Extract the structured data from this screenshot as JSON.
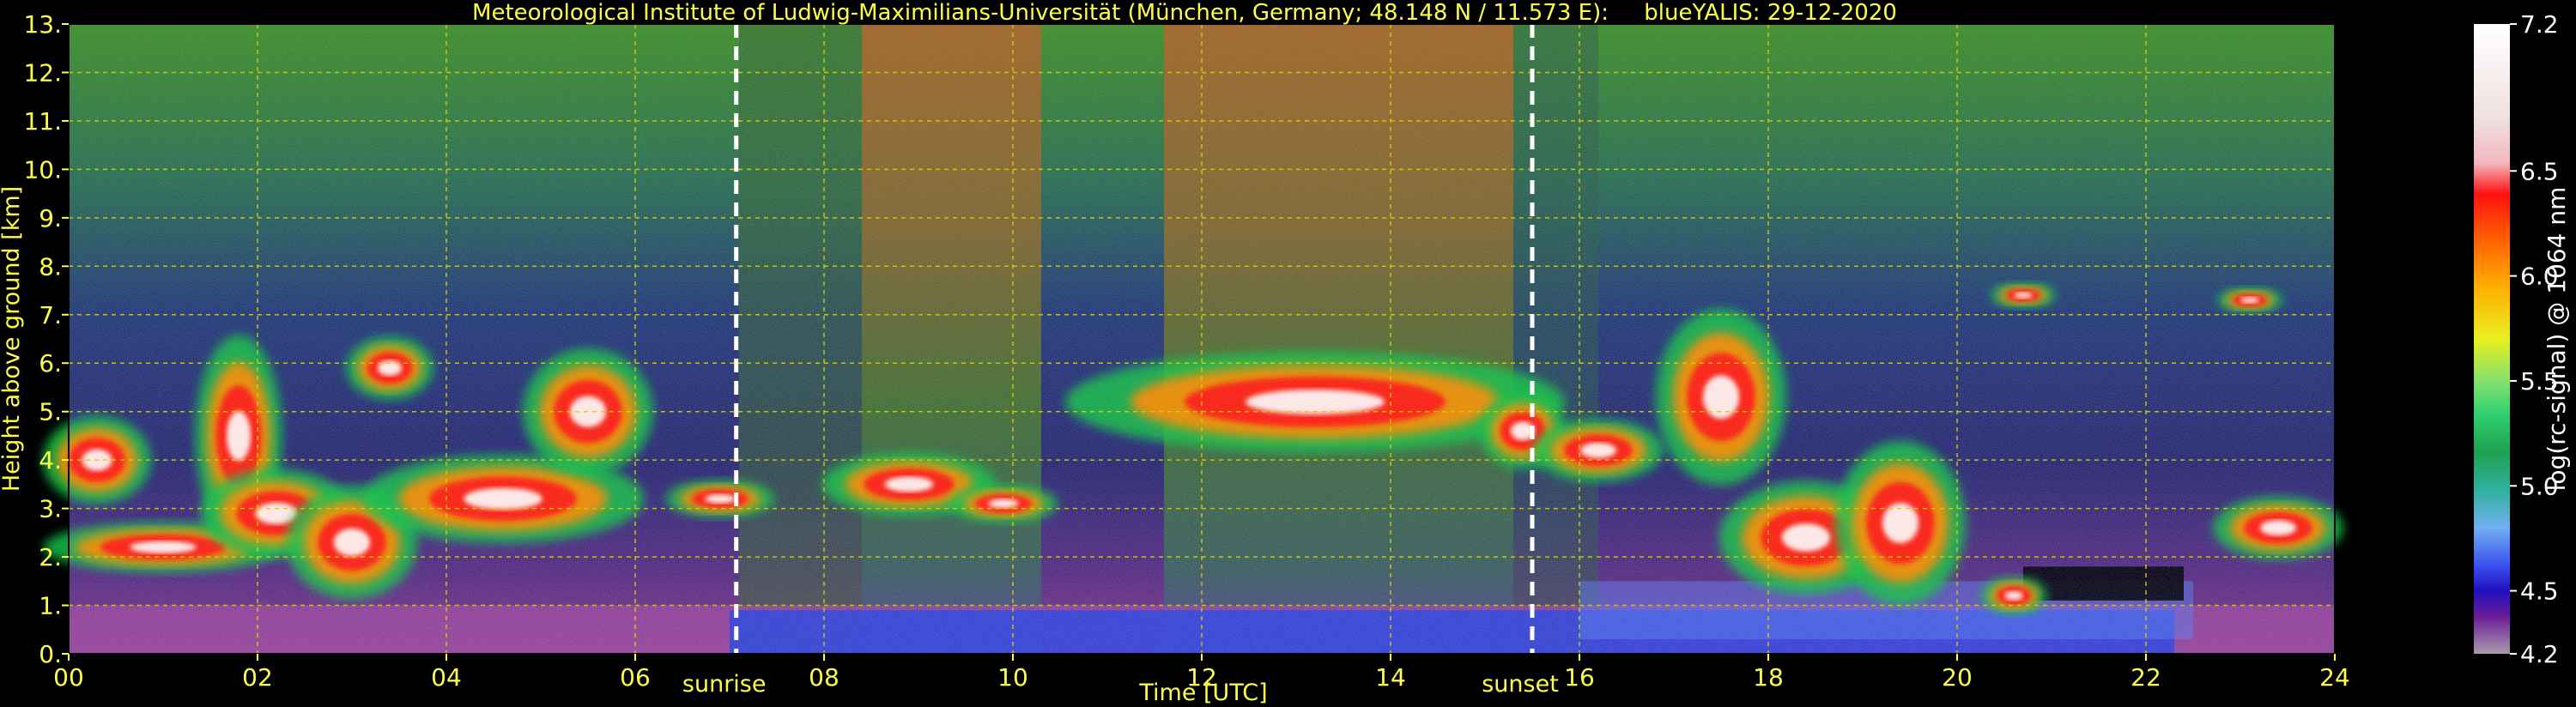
{
  "chart_data": {
    "type": "heatmap",
    "title": "Meteorological Institute of Ludwig-Maximilians-Universität (München, Germany; 48.148 N / 11.573 E):     blueYALIS: 29-12-2020",
    "xlabel": "Time [UTC]",
    "ylabel": "Height above ground [km]",
    "xlim": [
      0,
      24
    ],
    "ylim": [
      0,
      13
    ],
    "x_ticks": [
      "00",
      "02",
      "04",
      "06",
      "08",
      "10",
      "12",
      "14",
      "16",
      "18",
      "20",
      "22",
      "24"
    ],
    "x_tick_values": [
      0,
      2,
      4,
      6,
      8,
      10,
      12,
      14,
      16,
      18,
      20,
      22,
      24
    ],
    "y_ticks": [
      "0.",
      "1.",
      "2.",
      "3.",
      "4.",
      "5.",
      "6.",
      "7.",
      "8.",
      "9.",
      "10.",
      "11.",
      "12.",
      "13."
    ],
    "y_tick_values": [
      0,
      1,
      2,
      3,
      4,
      5,
      6,
      7,
      8,
      9,
      10,
      11,
      12,
      13
    ],
    "grid": true,
    "markers": [
      {
        "label": "sunrise",
        "time": 7.07
      },
      {
        "label": "sunset",
        "time": 15.5
      }
    ],
    "colorbar": {
      "label": "log(rc-signal) @ 1064 nm",
      "range": [
        4.2,
        7.2
      ],
      "ticks": [
        "7.2",
        "6.5",
        "6.0",
        "5.5",
        "5.0",
        "4.5",
        "4.2"
      ],
      "tick_values": [
        7.2,
        6.5,
        6.0,
        5.5,
        5.0,
        4.5,
        4.2
      ]
    },
    "colors": {
      "title": "#ffff44",
      "axis_text": "#ffff44",
      "grid": "#d8d000",
      "marker": "#ffffff",
      "colorbar_text": "#ffffff"
    }
  }
}
